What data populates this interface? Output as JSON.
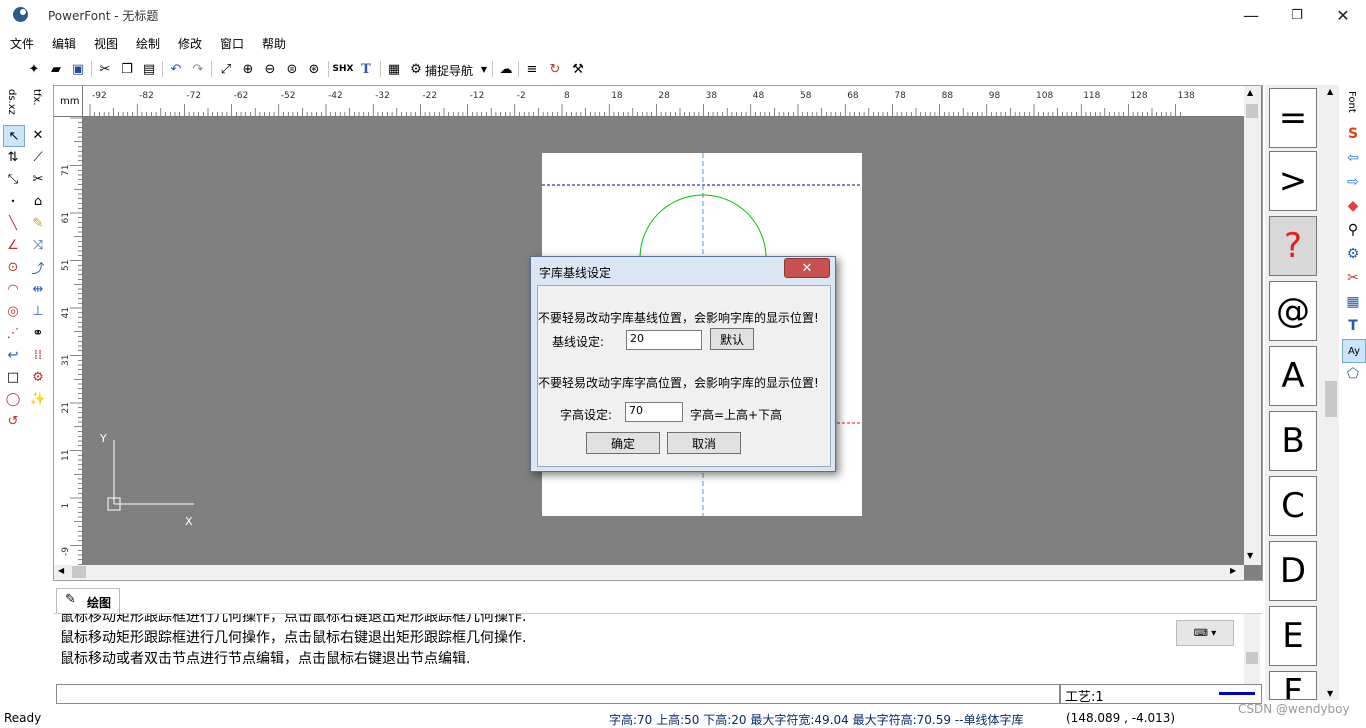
{
  "window": {
    "title": "PowerFont - 无标题",
    "minimize": "—",
    "restore": "❐",
    "close": "✕"
  },
  "menu": [
    "文件",
    "编辑",
    "视图",
    "绘制",
    "修改",
    "窗口",
    "帮助"
  ],
  "toolbar": {
    "shx_label": "SHX",
    "snap_nav_label": "捕捉导航",
    "icons": [
      "new-icon",
      "open-icon",
      "save-icon",
      "cut-icon",
      "copy-icon",
      "paste-icon",
      "undo-icon",
      "redo-icon",
      "zoom-window-icon",
      "zoom-in-icon",
      "zoom-out-icon",
      "zoom-extents-icon",
      "zoom-realtime-icon",
      "shx-icon",
      "truetype-icon",
      "grid-icon",
      "snap-nav-icon",
      "cloud-icon",
      "text-format-icon",
      "node-edit-icon",
      "settings-tools-icon"
    ]
  },
  "left_tabs": {
    "tab1": "ds.xz",
    "tab2": "tfx."
  },
  "ruler": {
    "unit": "mm",
    "h_ticks": [
      "-92",
      "-82",
      "-72",
      "-62",
      "-52",
      "-42",
      "-32",
      "-22",
      "-12",
      "-2",
      "8",
      "18",
      "28",
      "38",
      "48",
      "58",
      "68",
      "78",
      "88",
      "98",
      "108",
      "118",
      "128",
      "138"
    ],
    "v_ticks": [
      "71",
      "61",
      "51",
      "41",
      "31",
      "21",
      "11",
      "1",
      "-9"
    ]
  },
  "canvas": {
    "y_axis": "Y",
    "x_axis": "X"
  },
  "dialog": {
    "title": "字库基线设定",
    "close": "✕",
    "warning1": "不要轻易改动字库基线位置，会影响字库的显示位置!",
    "baseline_label": "基线设定:",
    "baseline_value": "20",
    "default_button": "默认",
    "warning2": "不要轻易改动字库字高位置，会影响字库的显示位置!",
    "height_label": "字高设定:",
    "height_value": "70",
    "height_formula": "字高=上高+下高",
    "ok_button": "确定",
    "cancel_button": "取消"
  },
  "output": {
    "tab_label": "绘图",
    "lines": [
      "鼠标移动矩形跟踪框进行几何操作，点击鼠标右键退出矩形跟踪框几何操作.",
      "鼠标移动矩形跟踪框进行几何操作，点击鼠标右键退出矩形跟踪框几何操作.",
      "鼠标移动或者双击节点进行节点编辑，点击鼠标右键退出节点编辑."
    ]
  },
  "craft": {
    "label": "工艺:1"
  },
  "glyphs": [
    "=",
    ">",
    "?",
    "@",
    "A",
    "B",
    "C",
    "D",
    "E",
    "F"
  ],
  "right_tab": "Font",
  "status": {
    "ready": "Ready",
    "metrics": "字高:70 上高:50 下高:20 最大字符宽:49.04  最大字符高:70.59  --单线体字库",
    "coords": "(148.089 , -4.013)",
    "watermark": "CSDN @wendyboy"
  },
  "colors": {
    "canvas_bg": "#808080",
    "baseline_dash": "#0000aa",
    "circle": "#00c000",
    "center_line": "#3aa0d8",
    "red_mark": "#ff0000",
    "craft_line": "#0000c0"
  }
}
